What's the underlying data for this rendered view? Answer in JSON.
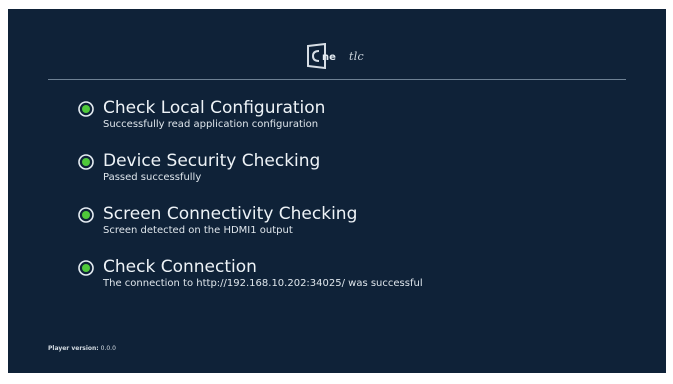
{
  "logo": {
    "tail_text": "tlc",
    "icon": "cinetilc-logo"
  },
  "checks": [
    {
      "title": "Check Local Configuration",
      "detail": "Successfully read application configuration",
      "icon": "check-circle-icon",
      "status_color": "#4fc93a"
    },
    {
      "title": "Device Security Checking",
      "detail": "Passed successfully",
      "icon": "check-circle-icon",
      "status_color": "#4fc93a"
    },
    {
      "title": "Screen Connectivity Checking",
      "detail": "Screen detected on the HDMI1 output",
      "icon": "check-circle-icon",
      "status_color": "#4fc93a"
    },
    {
      "title": "Check Connection",
      "detail": "The connection to http://192.168.10.202:34025/ was successful",
      "icon": "check-circle-icon",
      "status_color": "#4fc93a"
    }
  ],
  "footer": {
    "version_label": "Player version:",
    "version_value": "0.0.0"
  },
  "colors": {
    "background": "#0f2238",
    "success": "#4fc93a"
  }
}
